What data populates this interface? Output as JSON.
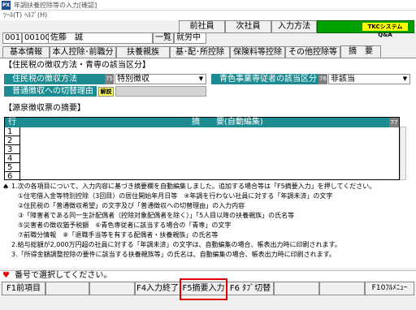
{
  "window": {
    "title": "年調扶養控除等の入力[確認]",
    "icon_text": "PX"
  },
  "menu": [
    "ﾂｰﾙ(T)",
    "ﾍﾙﾌﾟ(H)"
  ],
  "toolbar": {
    "prev": "前社員",
    "next": "次社員",
    "input_method": "入力方法",
    "logo_badge": "TKCシステムQ&A"
  },
  "employee": {
    "code_prefix": "001",
    "code": "001002",
    "name": "佐藤　誠",
    "list_label": "一覧",
    "status": "就労中"
  },
  "tabs": [
    "基本情報",
    "本人控除･前職分",
    "扶養親族",
    "基･配･所控除",
    "保険料等控除",
    "その他控除等",
    "摘　要"
  ],
  "section1": {
    "title": "【住民税の徴収方法・青専の該当区分】",
    "collection_label": "住民税の徴収方法",
    "collection_num": "75",
    "collection_value": "特別徴収",
    "aosen_label": "青色事業専従者の該当区分",
    "aosen_num": "76",
    "aosen_value": "非該当",
    "switch_label": "普通徴収への切替理由",
    "switch_button": "解説"
  },
  "section2": {
    "title": "【源泉徴収票の摘要】",
    "col_row": "行",
    "col_summary": "摘　　要(自動編集)",
    "col_num": "77",
    "rows": [
      "1",
      "2",
      "3",
      "4",
      "5",
      "6"
    ]
  },
  "notes": [
    "1.次の各項目について、入力内容に基づき摘要欄を自動編集しました。追加する場合等は「F5摘要入力」を押してください。",
    "①住宅借入金等特別控除（3回目）の居住開始年月日等　④年調を行わない社員に対する「年調未済」の文字",
    "②住民税の「普通徴収希望」の文字及び「普通徴収への切替理由」の入力内容",
    "③「障害者である同一生計配偶者（控除対象配偶者を除く）」「5人目以降の扶養親族」の氏名等",
    "⑤災害者の徴収猶予税額　⑥青色専従者に該当する場合の「青専」の文字",
    "⑦前職分情報　⑧「退職手当等を有する配偶者・扶養親族」の氏名等",
    "2.給与総額が2,000万円超の社員に対する「年調未済」の文字は、自動編集の場合、帳表出力時に印刷されます。",
    "3.「所得金額調整控除の要件に該当する扶養親族等」の氏名は、自動編集の場合、帳表出力時に印刷されます。"
  ],
  "status": {
    "text": "番号で選択してください。"
  },
  "fkeys": {
    "f1": "F1前項目",
    "f4": "F4入力終了",
    "f5": "F5摘要入力",
    "f6": "F6 ﾀﾌﾞ切替",
    "f10": "F10ﾌﾙﾒﾆｭｰ"
  },
  "colors": {
    "teal": "#1c8b92",
    "highlight": "#e00000",
    "logo_green": "#00a000"
  }
}
